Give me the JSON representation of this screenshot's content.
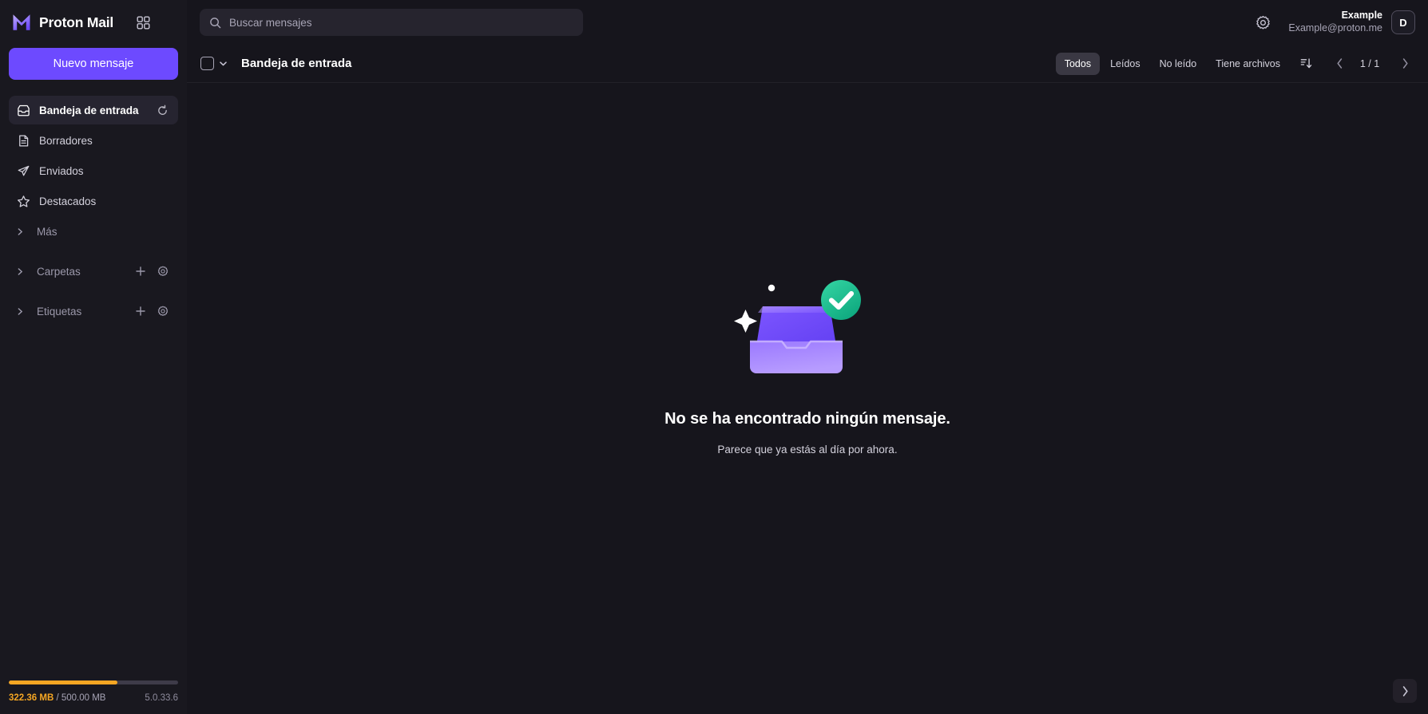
{
  "brand": {
    "name": "Proton Mail",
    "apps_icon": "app-grid-icon"
  },
  "search": {
    "placeholder": "Buscar mensajes",
    "value": "",
    "icon": "search-icon"
  },
  "account": {
    "settings_icon": "gear-icon",
    "display_name": "Example",
    "email": "Example@proton.me",
    "avatar_initial": "D"
  },
  "sidebar": {
    "compose_label": "Nuevo mensaje",
    "items": [
      {
        "label": "Bandeja de entrada",
        "icon": "inbox-icon",
        "active": true,
        "trailing_icon": "refresh-icon"
      },
      {
        "label": "Borradores",
        "icon": "draft-icon",
        "active": false,
        "trailing_icon": ""
      },
      {
        "label": "Enviados",
        "icon": "sent-icon",
        "active": false,
        "trailing_icon": ""
      },
      {
        "label": "Destacados",
        "icon": "star-icon",
        "active": false,
        "trailing_icon": ""
      },
      {
        "label": "Más",
        "icon": "",
        "active": false,
        "trailing_icon": ""
      }
    ],
    "groups": [
      {
        "label": "Carpetas",
        "add_icon": "plus-icon",
        "settings_icon": "gear-icon"
      },
      {
        "label": "Etiquetas",
        "add_icon": "plus-icon",
        "settings_icon": "gear-icon"
      }
    ],
    "storage": {
      "used": "322.36 MB",
      "separator": " / ",
      "total": "500.00 MB",
      "percent": 64,
      "version": "5.0.33.6",
      "fill_color": "#f5a623"
    }
  },
  "toolbar": {
    "folder_title": "Bandeja de entrada",
    "select_all_icon": "checkbox-icon",
    "select_all_caret": "chevron-down-icon",
    "filters": [
      {
        "label": "Todos",
        "active": true
      },
      {
        "label": "Leídos",
        "active": false
      },
      {
        "label": "No leído",
        "active": false
      },
      {
        "label": "Tiene archivos",
        "active": false
      }
    ],
    "sort_icon": "sort-descending-icon",
    "prev_icon": "chevron-left-icon",
    "next_icon": "chevron-right-icon",
    "page_indicator": "1 / 1"
  },
  "empty_state": {
    "illustration": "empty-inbox-tray-illustration",
    "title": "No se ha encontrado ningún mensaje.",
    "subtitle": "Parece que ya estás al día por ahora.",
    "colors": {
      "tray_light": "#b490ff",
      "tray_dark": "#6d4aff",
      "check_circle": "#1ea885",
      "check_circle_2": "#2ecc9a",
      "sparkle": "#ffffff"
    }
  },
  "footer": {
    "expand_icon": "chevron-right-icon"
  },
  "theme": {
    "bg": "#16151c",
    "sidebar_bg": "#19181f",
    "accent": "#6d4aff",
    "text": "#ffffff",
    "muted": "#a7a4b5",
    "active_pill": "#3a3843"
  }
}
